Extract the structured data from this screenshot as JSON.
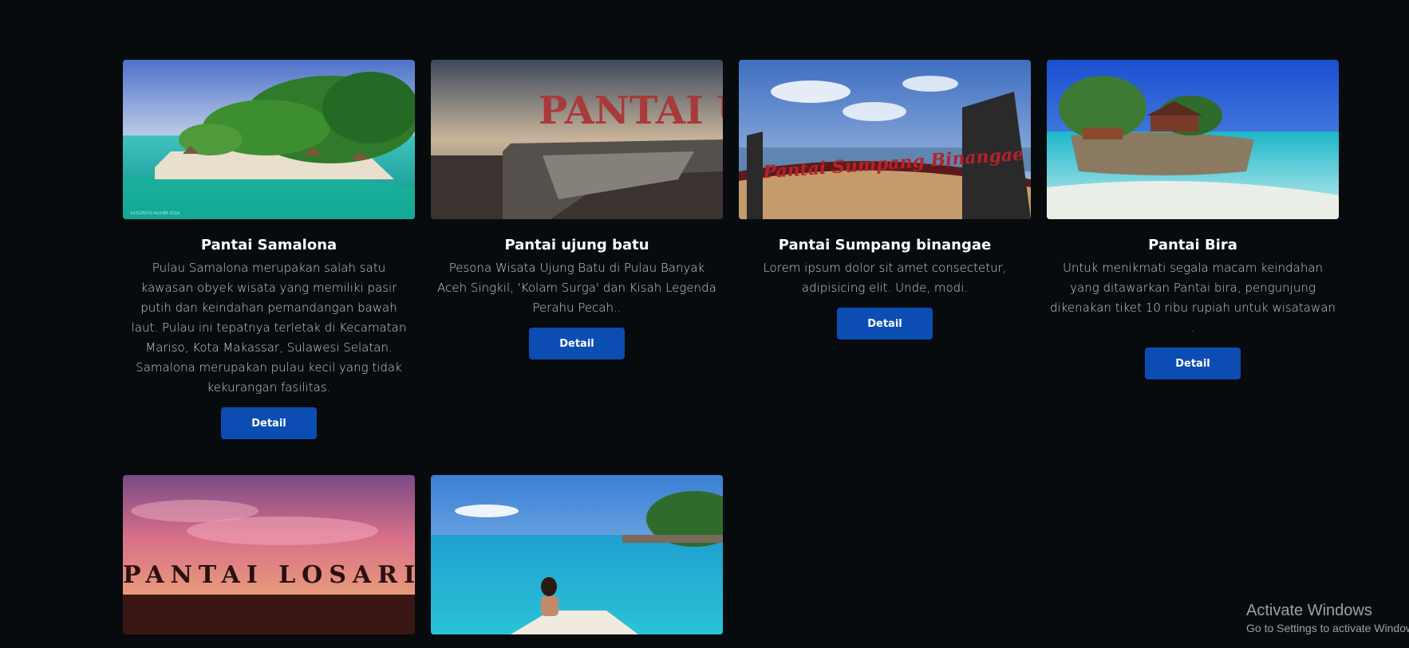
{
  "cards": [
    {
      "title": "Pantai Samalona",
      "description": "Pulau Samalona merupakan salah satu kawasan obyek wisata yang memiliki pasir putih dan keindahan pemandangan bawah laut. Pulau ini tepatnya terletak di Kecamatan Mariso, Kota Makassar, Sulawesi Selatan. Samalona merupakan pulau kecil yang tidak kekurangan fasilitas.",
      "button_label": "Detail",
      "image_caption": "EUCINTO ALEMI 2015"
    },
    {
      "title": "Pantai ujung batu",
      "description": "Pesona Wisata Ujung Batu di Pulau Banyak Aceh Singkil, 'Kolam Surga' dan Kisah Legenda Perahu Pecah..",
      "button_label": "Detail",
      "image_sign": "PANTAI  UJU"
    },
    {
      "title": "Pantai Sumpang binangae",
      "description": "Lorem ipsum dolor sit amet consectetur, adipisicing elit. Unde, modi.",
      "button_label": "Detail",
      "image_sign": "Pantai Sumpang Binangae"
    },
    {
      "title": "Pantai Bira",
      "description": "Untuk menikmati segala macam keindahan yang ditawarkan Pantai bira, pengunjung dikenakan tiket 10 ribu rupiah untuk wisatawan .",
      "button_label": "Detail"
    },
    {
      "image_sign": "PANTAI LOSARI"
    },
    {}
  ],
  "watermark": {
    "title": "Activate Windows",
    "subtitle": "Go to Settings to activate Windows."
  }
}
